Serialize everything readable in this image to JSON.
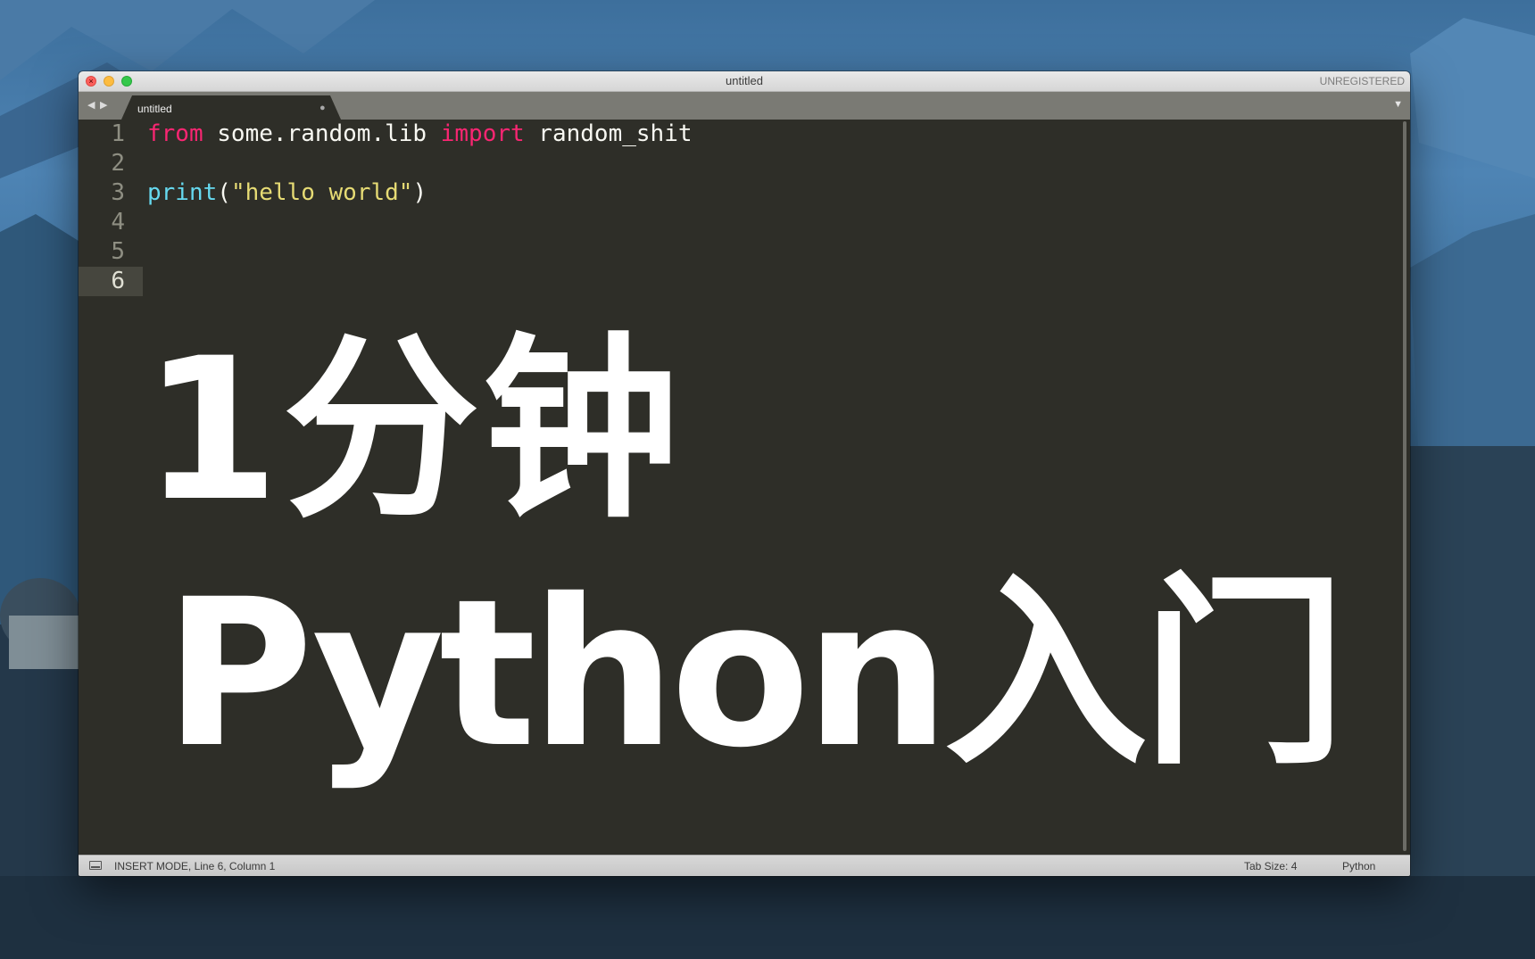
{
  "window": {
    "title": "untitled",
    "license_status": "UNREGISTERED"
  },
  "tabbar": {
    "nav_back_glyph": "◀",
    "nav_forward_glyph": "▶",
    "tab_title": "untitled",
    "tab_dirty_glyph": "●",
    "menu_glyph": "▼"
  },
  "editor": {
    "line_numbers": [
      "1",
      "2",
      "3",
      "4",
      "5",
      "6"
    ],
    "current_line": 6,
    "lines": [
      {
        "tokens": [
          {
            "type": "keyword",
            "text": "from"
          },
          {
            "type": "plain",
            "text": " some.random.lib "
          },
          {
            "type": "keyword",
            "text": "import"
          },
          {
            "type": "plain",
            "text": " random_shit"
          }
        ]
      },
      {
        "tokens": []
      },
      {
        "tokens": [
          {
            "type": "function",
            "text": "print"
          },
          {
            "type": "plain",
            "text": "("
          },
          {
            "type": "string",
            "text": "\"hello world\""
          },
          {
            "type": "plain",
            "text": ")"
          }
        ]
      }
    ]
  },
  "overlay": {
    "line1": "1分钟",
    "line2": "Python入门"
  },
  "statusbar": {
    "mode": "INSERT MODE, Line 6, Column 1",
    "tab_size": "Tab Size: 4",
    "syntax": "Python"
  },
  "colors": {
    "editor_bg": "#2e2e28",
    "keyword": "#f92672",
    "function": "#66d9ef",
    "string": "#e6db74",
    "plain": "#f8f8f2"
  }
}
